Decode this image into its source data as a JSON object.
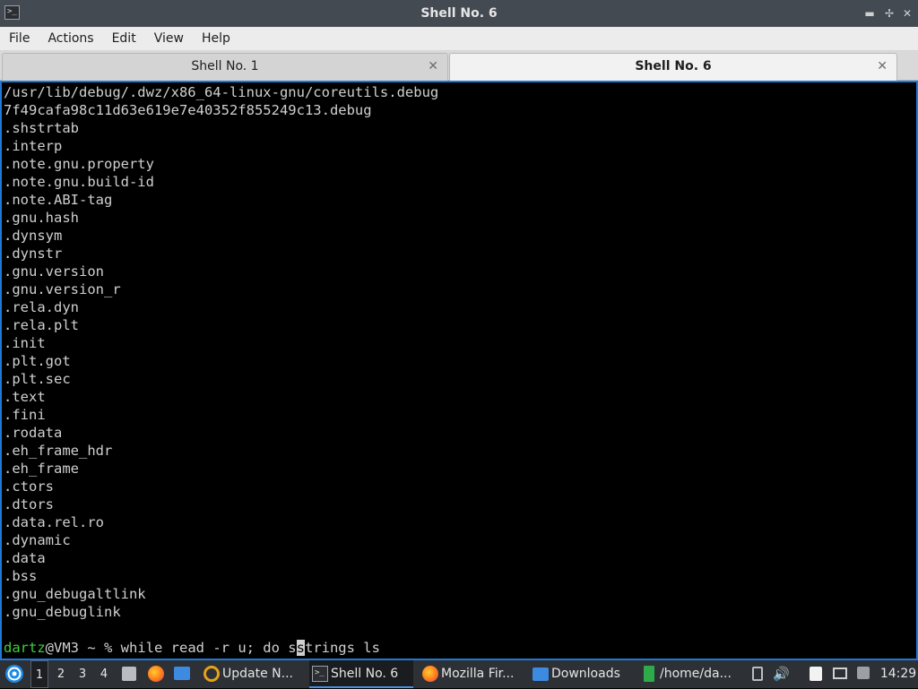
{
  "window": {
    "title": "Shell No. 6",
    "buttons": {
      "minimize": "▬",
      "restore": "✢",
      "close": "✕"
    }
  },
  "menu": [
    "File",
    "Actions",
    "Edit",
    "View",
    "Help"
  ],
  "tabs": [
    {
      "label": "Shell No. 1",
      "active": false
    },
    {
      "label": "Shell No. 6",
      "active": true
    }
  ],
  "terminal": {
    "lines": [
      "/usr/lib/debug/.dwz/x86_64-linux-gnu/coreutils.debug",
      "7f49cafa98c11d63e619e7e40352f855249c13.debug",
      ".shstrtab",
      ".interp",
      ".note.gnu.property",
      ".note.gnu.build-id",
      ".note.ABI-tag",
      ".gnu.hash",
      ".dynsym",
      ".dynstr",
      ".gnu.version",
      ".gnu.version_r",
      ".rela.dyn",
      ".rela.plt",
      ".init",
      ".plt.got",
      ".plt.sec",
      ".text",
      ".fini",
      ".rodata",
      ".eh_frame_hdr",
      ".eh_frame",
      ".ctors",
      ".dtors",
      ".data.rel.ro",
      ".dynamic",
      ".data",
      ".bss",
      ".gnu_debugaltlink",
      ".gnu_debuglink",
      ""
    ],
    "prompt": {
      "user": "dartz",
      "host_path": "@VM3 ~ % ",
      "command_before_cursor": "while read -r u; do s",
      "cursor_char": "s",
      "command_after_cursor": "trings ls"
    }
  },
  "taskbar": {
    "workspaces": [
      "1",
      "2",
      "3",
      "4"
    ],
    "tasks": [
      {
        "label": "Update N...",
        "icon": "update-icon"
      },
      {
        "label": "Shell No. 6",
        "icon": "terminal-icon",
        "active": true
      },
      {
        "label": "Mozilla Fir...",
        "icon": "firefox-icon"
      },
      {
        "label": "Downloads",
        "icon": "folder-icon"
      },
      {
        "label": "/home/da...",
        "icon": "file-manager-icon"
      }
    ],
    "clock": "14:29"
  },
  "colors": {
    "accent": "#1f7ad6",
    "prompt_user": "#3cd03c",
    "terminal_bg": "#000000",
    "terminal_fg": "#d0d0d0",
    "taskbar_bg": "#2d3035"
  }
}
